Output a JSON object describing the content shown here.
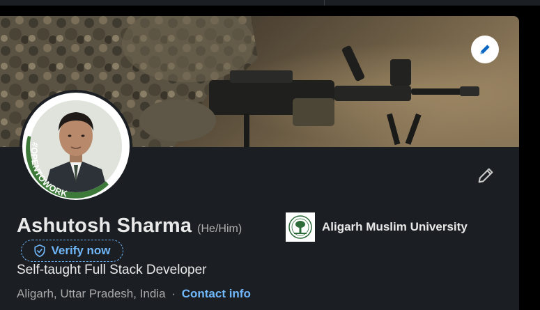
{
  "profile": {
    "name": "Ashutosh Sharma",
    "pronouns": "(He/Him)",
    "verify_label": "Verify now",
    "headline": "Self-taught Full Stack Developer",
    "location": "Aligarh, Uttar Pradesh, India",
    "separator": "·",
    "contact_label": "Contact info",
    "open_to_work_badge": "#OPENTOWORK"
  },
  "education": {
    "name": "Aligarh Muslim University",
    "logo_icon": "university-seal-icon"
  },
  "icons": {
    "banner_edit": "pencil-icon",
    "intro_edit": "pencil-icon",
    "verify": "shield-check-icon"
  },
  "colors": {
    "card_bg": "#1b1f23",
    "accent_link": "#71b7fb",
    "open_to_work_green": "#3d7a3a",
    "banner_edit_icon": "#0a66c2"
  }
}
